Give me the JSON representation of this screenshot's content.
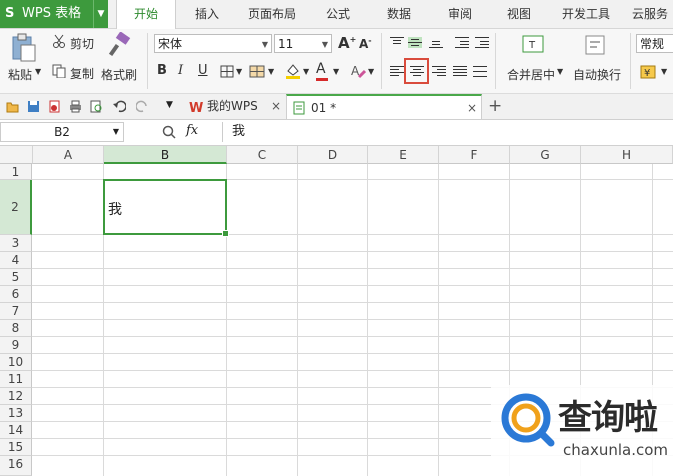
{
  "app": {
    "title": "WPS 表格",
    "logo": "S"
  },
  "menu_tabs": [
    "开始",
    "插入",
    "页面布局",
    "公式",
    "数据",
    "审阅",
    "视图",
    "开发工具",
    "云服务"
  ],
  "active_tab": "开始",
  "ribbon": {
    "paste": "粘贴",
    "cut": "剪切",
    "copy": "复制",
    "format_painter": "格式刷",
    "font_name": "宋体",
    "font_size": "11",
    "bold": "B",
    "italic": "I",
    "underline": "U",
    "font_color_letter": "A",
    "merge_center": "合并居中",
    "wrap_text": "自动换行",
    "number_format": "常规"
  },
  "doc_tabs": [
    {
      "label": "我的WPS"
    },
    {
      "label": "01 *"
    }
  ],
  "formula_bar": {
    "name_box": "B2",
    "fx": "fx",
    "value": "我"
  },
  "columns": [
    "A",
    "B",
    "C",
    "D",
    "E",
    "F",
    "G",
    "H"
  ],
  "rows": [
    "1",
    "2",
    "3",
    "4",
    "5",
    "6",
    "7",
    "8",
    "9",
    "10",
    "11",
    "12",
    "13",
    "14",
    "15",
    "16"
  ],
  "cell_B2": "我",
  "watermark": {
    "brand": "查询啦",
    "url": "chaxunla.com"
  },
  "colors": {
    "accent": "#3d9a3d",
    "highlight": "#d94b3c"
  }
}
